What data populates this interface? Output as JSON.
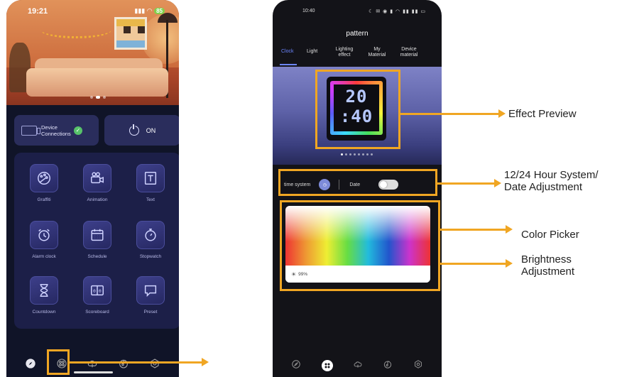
{
  "left_phone": {
    "status_time": "19:21",
    "status_battery": "85",
    "device_connections_label": "Device Connections",
    "power_label": "ON",
    "tiles": [
      {
        "label": "Graffiti"
      },
      {
        "label": "Animation"
      },
      {
        "label": "Text"
      },
      {
        "label": "Alarm clock"
      },
      {
        "label": "Schedule"
      },
      {
        "label": "Stopwatch"
      },
      {
        "label": "Countdown"
      },
      {
        "label": "Scoreboard"
      },
      {
        "label": "Preset"
      }
    ],
    "nav_icons": [
      "compass-icon",
      "pattern-icon",
      "cloud-icon",
      "music-icon",
      "settings-icon"
    ]
  },
  "right_phone": {
    "status_time": "10:40",
    "title": "pattern",
    "tabs": [
      {
        "label": "Clock",
        "active": true
      },
      {
        "label": "Light"
      },
      {
        "label": "Lighting effect"
      },
      {
        "label": "My Material"
      },
      {
        "label": "Device material"
      }
    ],
    "clock_preview": {
      "line1": "20",
      "line2": ":40"
    },
    "time_system_label": "time system",
    "date_label": "Date",
    "brightness": "99%",
    "nav_icons": [
      "compass-icon",
      "pattern-icon",
      "cloud-icon",
      "music-icon",
      "settings-icon"
    ]
  },
  "annotations": {
    "effect_preview": "Effect Preview",
    "hour_system_line1": "12/24 Hour System/",
    "hour_system_line2": "Date Adjustment",
    "color_picker": "Color Picker",
    "brightness_line1": "Brightness",
    "brightness_line2": "Adjustment"
  },
  "colors": {
    "annotation": "#f0a623",
    "accent_tab": "#6c86ff",
    "panel": "#1c1f48"
  }
}
